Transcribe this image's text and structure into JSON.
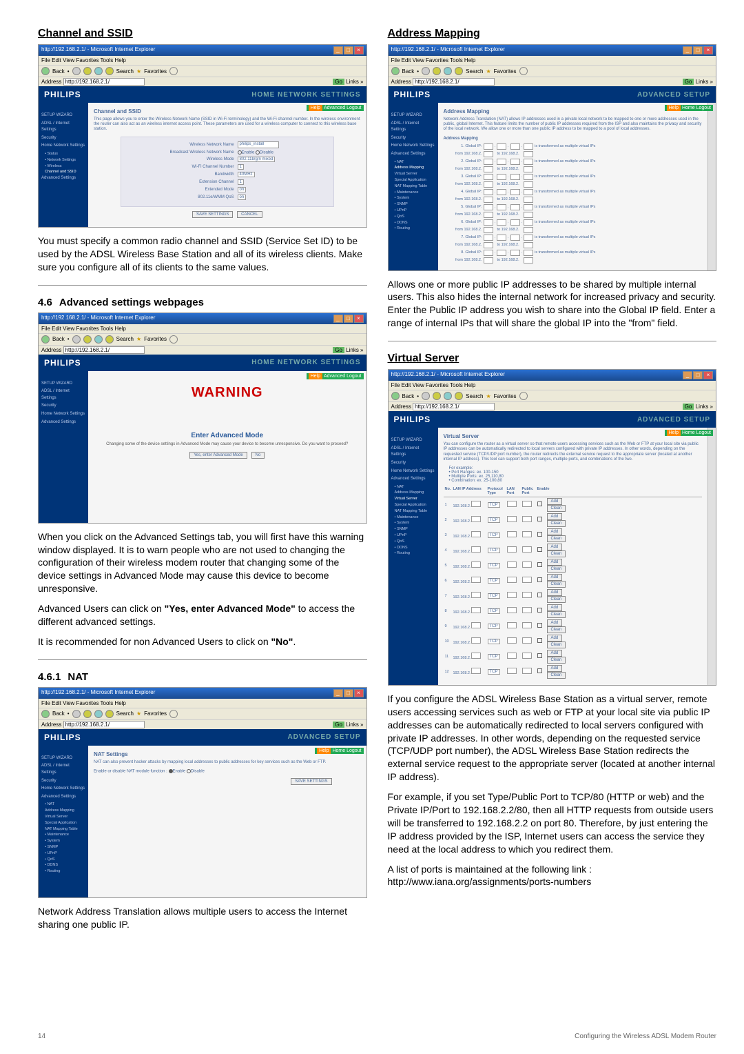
{
  "page_number": "14",
  "footer_text": "Configuring  the  Wireless  ADSL  Modem  Router",
  "browser": {
    "title": "http://192.168.2.1/ - Microsoft Internet Explorer",
    "menu": "File  Edit  View  Favorites  Tools  Help",
    "back": "Back",
    "search": "Search",
    "favorites": "Favorites",
    "address_label": "Address",
    "address": "http://192.168.2.1/",
    "go": "Go",
    "links": "Links"
  },
  "philips": {
    "brand": "PHILIPS",
    "home_title": "HOME NETWORK SETTINGS",
    "adv_title": "ADVANCED SETUP",
    "help": "Help",
    "home_logout": "Home  Logout",
    "advanced_logout": "Advanced  Logout"
  },
  "sidebar_home": [
    "SETUP WIZARD",
    "ADSL / Internet Settings",
    "Security",
    "Home Network Settings",
    "• Status",
    "• Network Settings",
    "• Wireless",
    "  Channel and SSID",
    "Advanced Settings"
  ],
  "sidebar_adv_basic": [
    "SETUP WIZARD",
    "ADSL / Internet Settings",
    "Security",
    "Home Network Settings",
    "Advanced Settings"
  ],
  "sidebar_nat": [
    "SETUP WIZARD",
    "ADSL / Internet Settings",
    "Security",
    "Home Network Settings",
    "Advanced Settings",
    "• NAT",
    "  Address Mapping",
    "  Virtual Server",
    "  Special Application",
    "  NAT Mapping Table",
    "• Maintenance",
    "• System",
    "• SNMP",
    "• UPnP",
    "• QoS",
    "• DDNS",
    "• Routing"
  ],
  "sidebar_addr": [
    "SETUP WIZARD",
    "ADSL / Internet Settings",
    "Security",
    "Home Network Settings",
    "Advanced Settings",
    "• NAT",
    "  Address Mapping",
    "  Virtual Server",
    "  Special Application",
    "  NAT Mapping Table",
    "• Maintenance",
    "• System",
    "• SNMP",
    "• UPnP",
    "• QoS",
    "• DDNS",
    "• Routing"
  ],
  "channel": {
    "heading": "Channel and SSID",
    "panel_title": "Channel and SSID",
    "panel_desc": "This page allows you to enter the Wireless Network Name (SSID in Wi-Fi terminology) and the Wi-Fi channel number. In the wireless environment the router can also act as an wireless internet access point. These parameters are used for a wireless computer to connect to this wireless base station.",
    "labels": {
      "wnn": "Wireless Network Name",
      "bwnn": "Broadcast Wireless Network Name",
      "wmode": "Wireless Mode",
      "wifich": "Wi-Fi Channel Number",
      "bw": "Bandwidth",
      "extch": "Extension Channel",
      "exmode": "Extended Mode",
      "age": "802.11e/WMM QoS"
    },
    "values": {
      "wnn": "philips_install",
      "enable": "Enable",
      "disable": "Disable",
      "wmode": "802.11b/g/n mixed",
      "wifich": "1",
      "bw": "40MHz",
      "extch": "1",
      "exmode": "on",
      "age": "on"
    },
    "save": "SAVE SETTINGS",
    "cancel": "CANCEL",
    "body": "You must specify a common radio channel and SSID (Service Set ID) to be used by the ADSL Wireless Base Station and all of its wireless clients. Make sure you configure all of its clients to the same values."
  },
  "adv": {
    "heading_num": "4.6",
    "heading": "Advanced settings webpages",
    "warning": "WARNING",
    "enter": "Enter Advanced Mode",
    "note": "Changing some of the device settings in Advanced Mode may cause your device to become unresponsive. Do you want to proceed?",
    "yes": "Yes, enter Advanced Mode",
    "no": "No",
    "body1": "When you click on the Advanced Settings tab, you will first have this warning window displayed. It is to warn people who are not used to changing the configuration of their wireless modem router that changing some of the device settings in Advanced Mode may cause this device to become unresponsive.",
    "body2_pre": "Advanced Users can click on ",
    "body2_bold": "\"Yes, enter Advanced Mode\"",
    "body2_post": " to access the different advanced settings.",
    "body3_pre": "It is recommended for non Advanced Users to click on ",
    "body3_bold": "\"No\"",
    "body3_post": "."
  },
  "nat": {
    "heading_num": "4.6.1",
    "heading": "NAT",
    "panel_title": "NAT Settings",
    "panel_desc": "NAT can also prevent hacker attacks by mapping local addresses to public addresses for key services such as the Web or FTP.",
    "enable_label": "Enable or disable NAT module function :",
    "enable": "Enable",
    "disable": "Disable",
    "save": "SAVE SETTINGS",
    "body": "Network Address Translation allows multiple users to access the Internet sharing one public IP."
  },
  "addr": {
    "heading": "Address Mapping",
    "panel_title": "Address Mapping",
    "panel_desc": "Network Address Translation (NAT) allows IP addresses used in a private local network to be mapped to one or more addresses used in the public, global Internet. This feature limits the number of public IP addresses required from the ISP and also maintains the privacy and security of the local network. We allow one or more than one public IP address to be mapped to a pool of local addresses.",
    "section": "Address Mapping",
    "global_label": "Global IP:",
    "trans_text": "is transformed as multiple virtual IPs",
    "from": "from 192.168.2.",
    "to": "to 192.168.2.",
    "rows": [
      "1",
      "2",
      "3",
      "4",
      "5",
      "6",
      "7",
      "8"
    ],
    "body": "Allows one or more public IP addresses to be shared by multiple internal users. This also hides the internal network for increased privacy and security. Enter the Public IP address you wish to share into the Global IP field. Enter a range of internal IPs that will share the global IP into the \"from\" field."
  },
  "vs": {
    "heading": "Virtual Server",
    "panel_title": "Virtual Server",
    "panel_desc": "You can configure the router as a virtual server so that remote users accessing services such as the Web or FTP at your local site via public IP addresses can be automatically redirected to local servers configured with private IP addresses. In other words, depending on the requested service (TCP/UDP port number), the router redirects the external service request to the appropriate server (located at another internal IP address). This tool can support both port ranges, multiple ports, and combinations of the two.",
    "example_label": "For example:",
    "examples": [
      "• Port Ranges: ex. 100-150",
      "• Multiple Ports: ex. 25,110,80",
      "• Combination: ex. 25-100,80"
    ],
    "headers": {
      "no": "No.",
      "lan": "LAN IP Address",
      "proto": "Protocol Type",
      "lanport": "LAN Port",
      "pubport": "Public Port",
      "enable": "Enable"
    },
    "ip_prefix": "192.168.2.",
    "proto_val": "TCP",
    "add": "Add",
    "clean": "Clean",
    "rows": [
      "1",
      "2",
      "3",
      "4",
      "5",
      "6",
      "7",
      "8",
      "9",
      "10",
      "11",
      "12"
    ],
    "body1": "If you configure the ADSL Wireless Base Station as a virtual server, remote users accessing services such as web or FTP at your local site via public IP addresses can be automatically redirected to local servers configured with private IP addresses. In other words, depending on the requested service (TCP/UDP port number), the ADSL Wireless Base Station redirects the external service request to the appropriate server (located at another internal IP address).",
    "body2": "For example, if you set Type/Public Port to TCP/80 (HTTP or web) and the Private IP/Port to 192.168.2.2/80, then all HTTP requests from outside users will be transferred to 192.168.2.2 on port 80. Therefore, by just entering the IP address provided by the ISP, Internet users can access the service they need at the local address to which you redirect them.",
    "body3": "A list of ports is maintained at the following link : http://www.iana.org/assignments/ports-numbers"
  }
}
